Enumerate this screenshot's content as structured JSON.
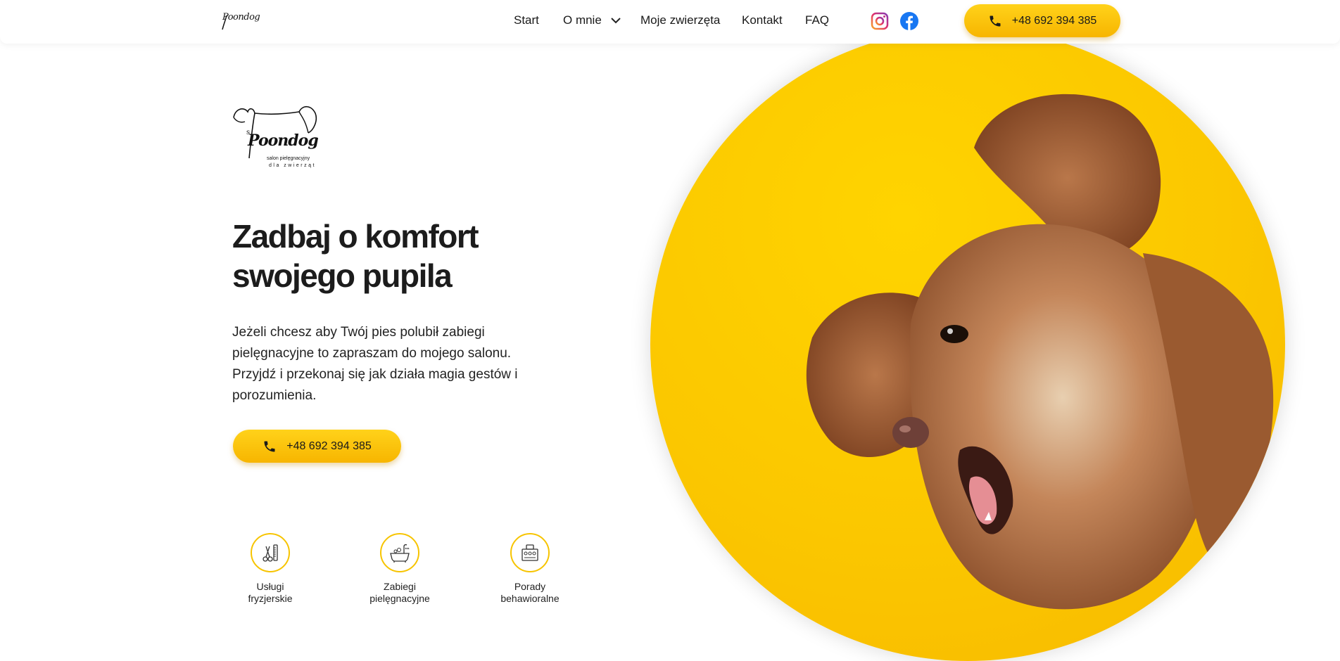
{
  "brand": {
    "small_logo_text": "Poondog",
    "big_logo_text": "Poondog",
    "big_logo_sub1": "salon pielęgnacyjny",
    "big_logo_sub2": "dla zwierząt"
  },
  "nav": {
    "items": [
      {
        "label": "Start"
      },
      {
        "label": "O mnie"
      },
      {
        "label": "Moje zwierzęta"
      },
      {
        "label": "Kontakt"
      },
      {
        "label": "FAQ"
      }
    ],
    "social": [
      "instagram-icon",
      "facebook-icon"
    ],
    "phone_button": "+48 692 394 385"
  },
  "hero": {
    "title_line1": "Zadbaj o komfort",
    "title_line2": "swojego pupila",
    "text_line1": "Jeżeli chcesz aby Twój pies polubił zabiegi",
    "text_line2": "pielęgnacyjne to zapraszam do mojego salonu.",
    "text_line3": "Przyjdź i przekonaj się jak działa magia gestów i",
    "text_line4": "porozumienia.",
    "phone_button": "+48 692 394 385"
  },
  "features": [
    {
      "line1": "Usługi",
      "line2": "fryzjerskie",
      "icon": "scissors-comb-icon"
    },
    {
      "line1": "Zabiegi",
      "line2": "pielęgnacyjne",
      "icon": "bath-icon"
    },
    {
      "line1": "Porady",
      "line2": "behawioralne",
      "icon": "training-icon"
    }
  ],
  "colors": {
    "accent": "#fbc700",
    "accent_dark": "#f7b500",
    "text": "#1a1a1a"
  }
}
